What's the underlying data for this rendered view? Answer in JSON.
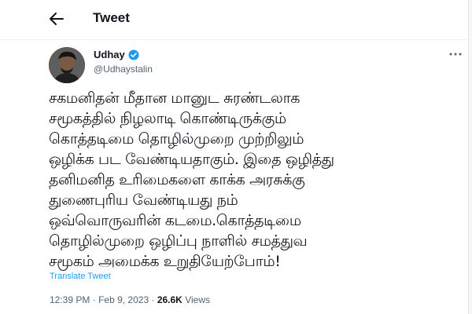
{
  "header": {
    "title": "Tweet",
    "back_icon": "arrow-left-icon"
  },
  "author": {
    "display_name": "Udhay",
    "handle": "@Udhaystalin",
    "verified": true,
    "verified_color": "#1d9bf0"
  },
  "tweet": {
    "lines": [
      "சகமனிதன் மீதான மானுட சுரண்டலாக",
      "சமூகத்தில் நிழலாடி கொண்டிருக்கும்",
      "கொத்தடிமை தொழில்முறை முற்றிலும்",
      "ஒழிக்க பட வேண்டியதாகும். இதை ஒழித்து",
      "தனிமனித உரிமைகளை காக்க அரசுக்கு",
      "துணைபுரிய வேண்டியது நம்",
      "ஒவ்வொருவரின் கடமை.கொத்தடிமை",
      "தொழில்முறை ஒழிப்பு நாளில் சமத்துவ",
      "சமூகம் அமைக்க உறுதியேற்போம்!"
    ],
    "translate_label": "Translate Tweet"
  },
  "meta": {
    "time": "12:39 PM",
    "separator": "·",
    "date": "Feb 9, 2023",
    "views_count": "26.6K",
    "views_label": "Views"
  },
  "colors": {
    "accent": "#1d9bf0",
    "text": "#0f1419",
    "secondary": "#536471"
  }
}
